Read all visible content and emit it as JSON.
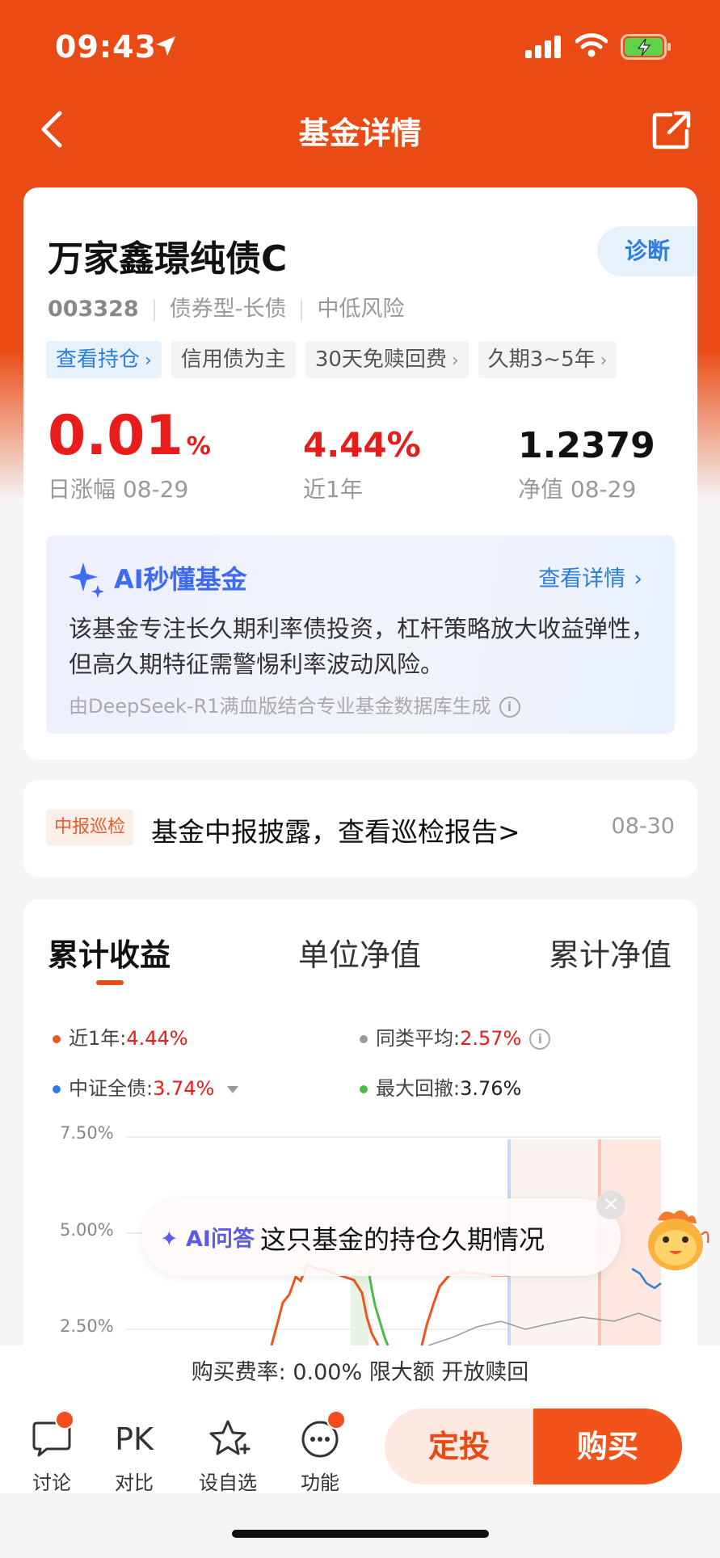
{
  "status_bar": {
    "time": "09:43"
  },
  "nav": {
    "title": "基金详情"
  },
  "fund": {
    "name": "万家鑫璟纯债C",
    "diagnose_label": "诊断",
    "code": "003328",
    "type": "债券型-长债",
    "risk": "中低风险",
    "tags": [
      {
        "label": "查看持仓",
        "style": "blue"
      },
      {
        "label": "信用债为主",
        "style": "gray"
      },
      {
        "label": "30天免赎回费",
        "style": "gray"
      },
      {
        "label": "久期3~5年",
        "style": "gray"
      }
    ],
    "daily_change": "0.01",
    "daily_change_unit": "%",
    "daily_change_label": "日涨幅 08-29",
    "year_return": "4.44%",
    "year_return_label": "近1年",
    "nav_value": "1.2379",
    "nav_label": "净值 08-29"
  },
  "ai_summary": {
    "title": "AI秒懂基金",
    "link": "查看详情",
    "text": "该基金专注长久期利率债投资，杠杆策略放大收益弹性，但高久期特征需警惕利率波动风险。",
    "footer": "由DeepSeek-R1满血版结合专业基金数据库生成"
  },
  "notice": {
    "badge": "中报巡检",
    "text": "基金中报披露，查看巡检报告>",
    "date": "08-30"
  },
  "chart_tabs": {
    "tab1": "累计收益",
    "tab2": "单位净值",
    "tab3": "累计净值"
  },
  "legend": {
    "l1_label": "近1年:",
    "l1_value": "4.44%",
    "l1_color": "#f0541f",
    "l2_label": "同类平均:",
    "l2_value": "2.57%",
    "l2_color": "#9a9a9a",
    "l3_label": "中证全债:",
    "l3_value": "3.74%",
    "l3_color": "#2a7de1",
    "l4_label": "最大回撤:",
    "l4_value": "3.76%",
    "l4_color": "#4cbb45"
  },
  "chart_data": {
    "type": "line",
    "y_ticks": [
      "7.50%",
      "5.00%",
      "2.50%"
    ],
    "series": []
  },
  "ai_popup": {
    "label": "AI问答",
    "question": "这只基金的持仓久期情况"
  },
  "fee_bar": {
    "text": "购买费率: 0.00% 限大额 开放赎回"
  },
  "bottom_bar": {
    "discuss": "讨论",
    "compare_glyph": "PK",
    "compare": "对比",
    "watchlist": "设自选",
    "functions": "功能",
    "auto_invest": "定投",
    "buy": "购买"
  }
}
